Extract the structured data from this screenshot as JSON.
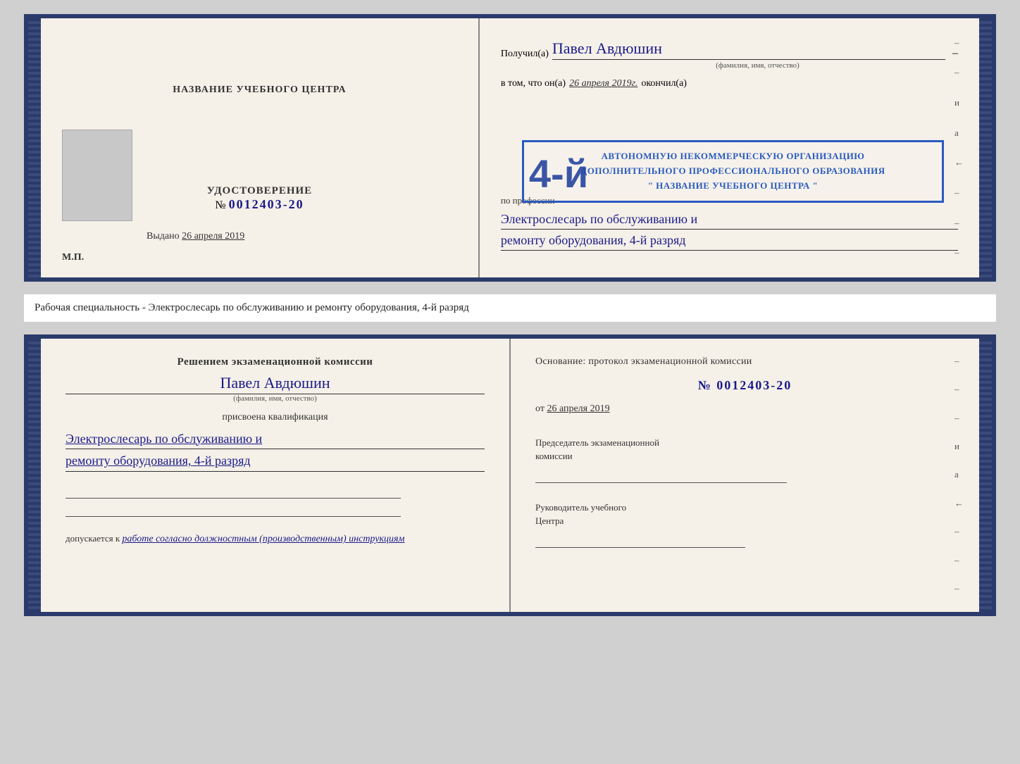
{
  "top_cert": {
    "left": {
      "center_title": "НАЗВАНИЕ УЧЕБНОГО ЦЕНТРА",
      "cert_label": "УДОСТОВЕРЕНИЕ",
      "cert_number_prefix": "№",
      "cert_number": "0012403-20",
      "issued_label": "Выдано",
      "issued_date": "26 апреля 2019",
      "mp_label": "М.П."
    },
    "right": {
      "recipient_label": "Получил(а)",
      "recipient_name": "Павел Авдюшин",
      "recipient_subtitle": "(фамилия, имя, отчество)",
      "vtom_prefix": "в том, что он(а)",
      "vtom_date": "26 апреля 2019г.",
      "vtom_finished": "окончил(а)",
      "org_line1": "АВТОНОМНУЮ НЕКОММЕРЧЕСКУЮ ОРГАНИЗАЦИЮ",
      "org_line2": "ДОПОЛНИТЕЛЬНОГО ПРОФЕССИОНАЛЬНОГО ОБРАЗОВАНИЯ",
      "org_name": "\" НАЗВАНИЕ УЧЕБНОГО ЦЕНТРА \"",
      "profession_label": "по профессии",
      "profession_line1": "Электрослесарь по обслуживанию и",
      "profession_line2": "ремонту оборудования, 4-й разряд",
      "big_number": "4-й"
    }
  },
  "middle_text": "Рабочая специальность - Электрослесарь по обслуживанию и ремонту оборудования, 4-й разряд",
  "bottom_cert": {
    "left": {
      "commission_title": "Решением экзаменационной комиссии",
      "person_name": "Павел Авдюшин",
      "person_subtitle": "(фамилия, имя, отчество)",
      "assigned_label": "присвоена квалификация",
      "qualification_line1": "Электрослесарь по обслуживанию и",
      "qualification_line2": "ремонту оборудования, 4-й разряд",
      "допускается_prefix": "допускается к",
      "допускается_value": "работе согласно должностным (производственным) инструкциям"
    },
    "right": {
      "основание_label": "Основание: протокол экзаменационной комиссии",
      "protocol_number": "№  0012403-20",
      "protocol_date_prefix": "от",
      "protocol_date": "26 апреля 2019",
      "chairman_line1": "Председатель экзаменационной",
      "chairman_line2": "комиссии",
      "director_line1": "Руководитель учебного",
      "director_line2": "Центра"
    }
  },
  "side_marks": {
    "items": [
      "–",
      "–",
      "и",
      "а",
      "←",
      "–",
      "–",
      "–"
    ]
  }
}
